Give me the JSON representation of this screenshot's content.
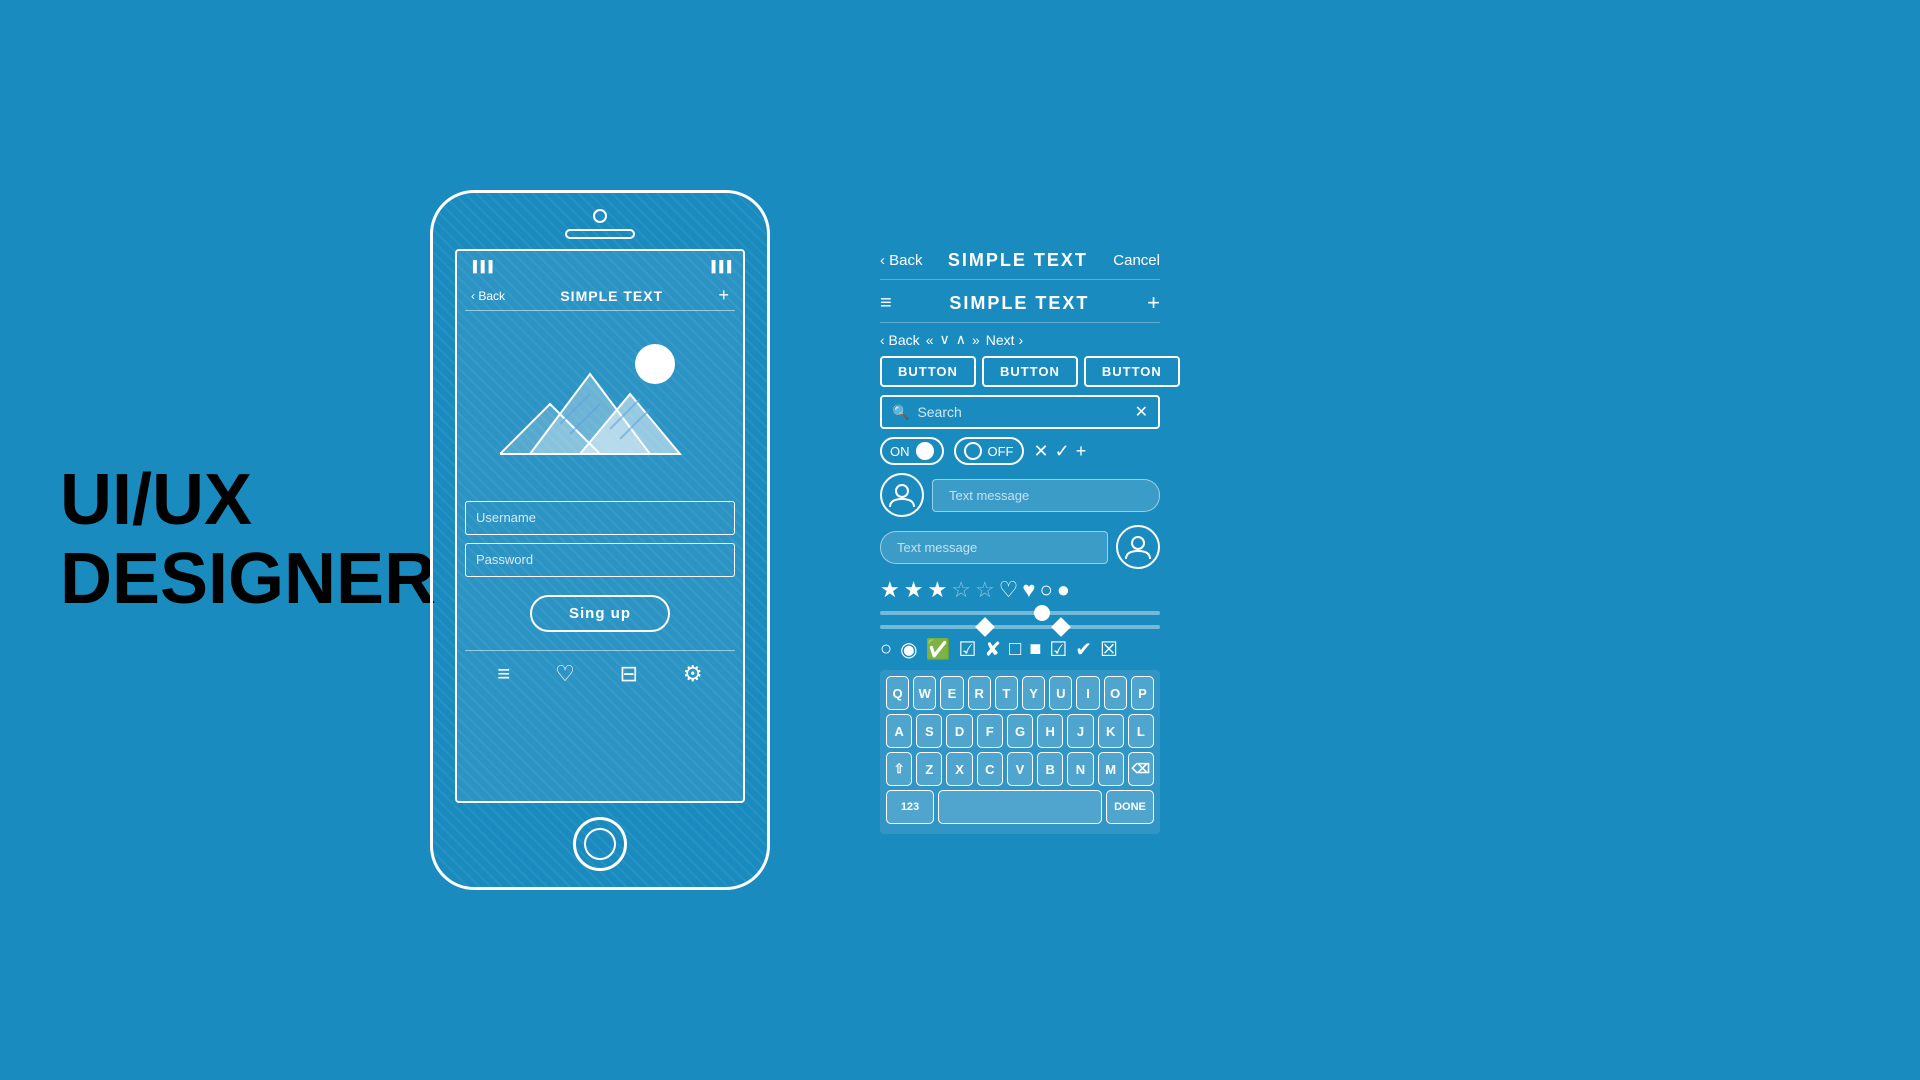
{
  "page": {
    "background_color": "#1a8bbf"
  },
  "hero_text": {
    "line1": "UI/UX",
    "line2": "DESIGNER"
  },
  "phone": {
    "status": {
      "signal": "▐▐▐",
      "battery": "▐▐▐"
    },
    "nav": {
      "back": "‹ Back",
      "title": "SIMPLE TEXT",
      "plus": "+"
    },
    "username_placeholder": "Username",
    "password_placeholder": "Password",
    "signup_label": "Sing up",
    "bottom_icons": [
      "≡",
      "♡",
      "⊟",
      "⚙"
    ]
  },
  "ui_kit": {
    "top_nav": {
      "back": "‹ Back",
      "title": "SIMPLE TEXT",
      "cancel": "Cancel"
    },
    "second_nav": {
      "hamburger": "≡",
      "title": "SIMPLE TEXT",
      "plus": "+"
    },
    "nav_buttons": {
      "back": "‹ Back",
      "prev_prev": "«",
      "down": "∨",
      "up": "∧",
      "next_next": "»",
      "next": "Next ›"
    },
    "buttons": [
      "BUTTON",
      "BUTTON",
      "BUTTON"
    ],
    "search": {
      "placeholder": "Search",
      "clear": "✕"
    },
    "toggles": {
      "on_label": "ON",
      "off_label": "OFF"
    },
    "chat": {
      "message_left": "Text message",
      "message_right": "Text message"
    },
    "keyboard": {
      "rows": [
        [
          "Q",
          "W",
          "E",
          "R",
          "T",
          "Y",
          "U",
          "I",
          "O",
          "P"
        ],
        [
          "A",
          "S",
          "D",
          "F",
          "G",
          "H",
          "J",
          "K",
          "L"
        ],
        [
          "⇧",
          "Z",
          "X",
          "C",
          "V",
          "B",
          "N",
          "M",
          "⌫"
        ]
      ],
      "bottom_left": "123",
      "bottom_right": "DONE"
    }
  }
}
